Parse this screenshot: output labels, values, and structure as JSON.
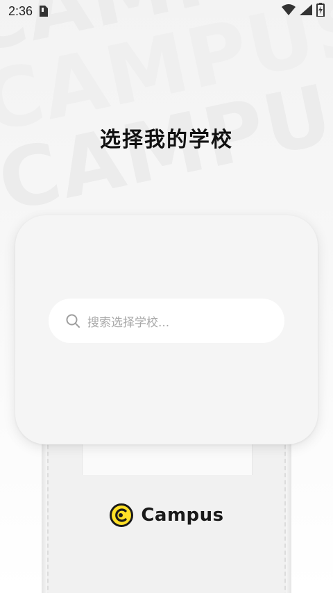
{
  "status_bar": {
    "time": "2:36",
    "icons": [
      "sim-card-icon",
      "wifi-icon",
      "cell-signal-icon",
      "battery-icon"
    ]
  },
  "watermark": {
    "lines": [
      "CAMPUS",
      "CAMPUS",
      "CAMPUS"
    ]
  },
  "page": {
    "title": "选择我的学校"
  },
  "search": {
    "placeholder": "搜索选择学校..."
  },
  "brand": {
    "name": "Campus",
    "logo_icon": "campus-logo-icon",
    "accent_color": "#FFE027"
  }
}
